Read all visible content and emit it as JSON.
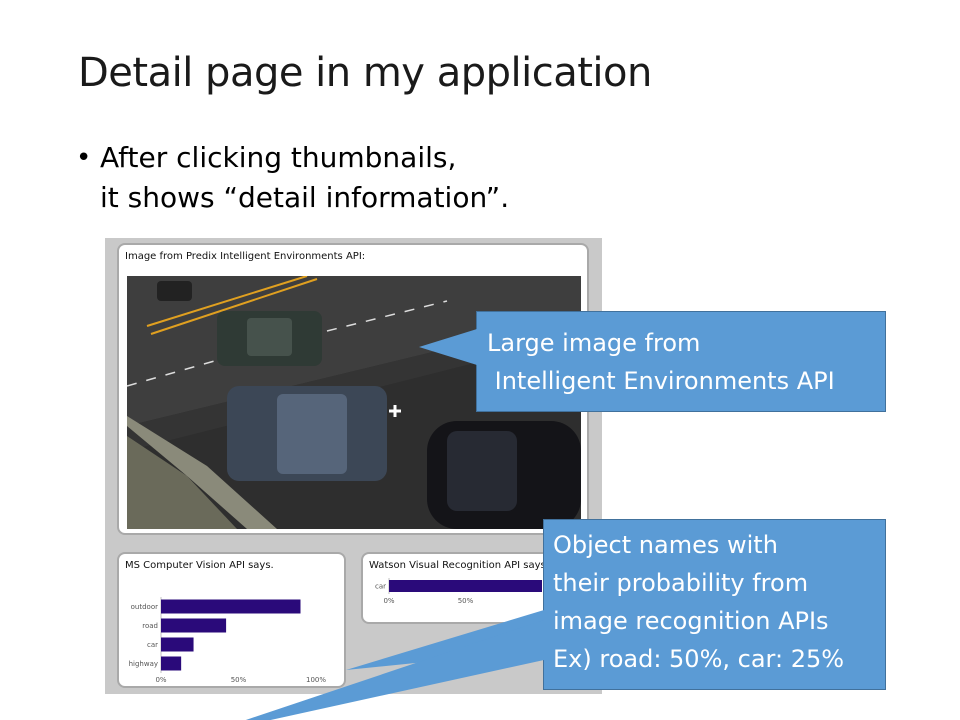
{
  "title": "Detail page in my application",
  "bullet": {
    "line1": "After clicking thumbnails,",
    "line2": "it shows “detail information”."
  },
  "screenshot": {
    "main_panel_title": "Image from Predix Intelligent Environments API:",
    "ms_panel_title": "MS Computer Vision API says.",
    "watson_panel_title": "Watson Visual Recognition API says:"
  },
  "callouts": {
    "large_image": [
      "Large image from",
      " Intelligent Environments API"
    ],
    "object_names": [
      "Object names with",
      "their probability from",
      "image recognition APIs",
      "Ex) road: 50%, car: 25%"
    ]
  },
  "chart_data": [
    {
      "type": "bar",
      "orientation": "horizontal",
      "title": "MS Computer Vision API says.",
      "categories": [
        "outdoor",
        "road",
        "car",
        "highway"
      ],
      "values": [
        90,
        42,
        21,
        13
      ],
      "xlim": [
        0,
        100
      ],
      "xticks": [
        "0%",
        "50%",
        "100%"
      ],
      "color": "#2a0a7a"
    },
    {
      "type": "bar",
      "orientation": "horizontal",
      "title": "Watson Visual Recognition API says:",
      "categories": [
        "car"
      ],
      "values": [
        100
      ],
      "xlim": [
        0,
        100
      ],
      "xticks": [
        "0%",
        "50%"
      ],
      "color": "#2a0a7a"
    }
  ],
  "colors": {
    "callout": "#5b9bd5",
    "bar": "#2a0a7a"
  }
}
